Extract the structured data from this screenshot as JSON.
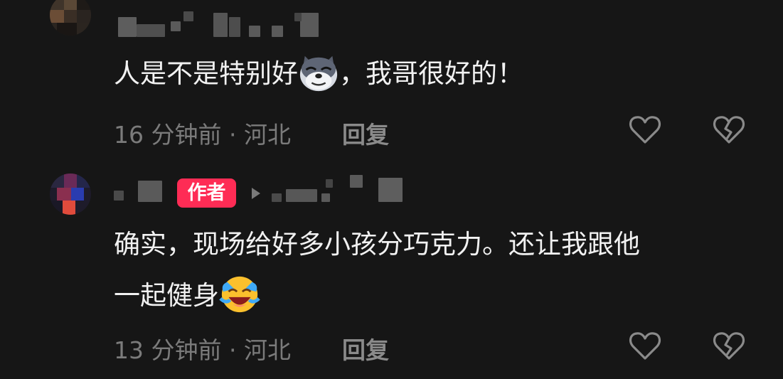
{
  "comments": [
    {
      "text_before": "人是不是特别好",
      "emoji1": "doge-emoji",
      "text_after": "，我哥很好的！",
      "time": "16 分钟前 · 河北",
      "reply": "回复",
      "icons": [
        "heart-outline-icon",
        "broken-heart-icon"
      ]
    },
    {
      "badge": "作者",
      "text_line1": "确实，现场给好多小孩分巧克力。还让我跟他",
      "text_line2": "一起健身",
      "emoji2": "laugh-cry-emoji",
      "time": "13 分钟前 · 河北",
      "reply": "回复",
      "icons": [
        "heart-outline-icon",
        "broken-heart-icon"
      ]
    }
  ],
  "colors": {
    "background": "#161616",
    "badge": "#fe2c55",
    "meta": "#7b7b7b",
    "text": "#f1f1f1"
  }
}
